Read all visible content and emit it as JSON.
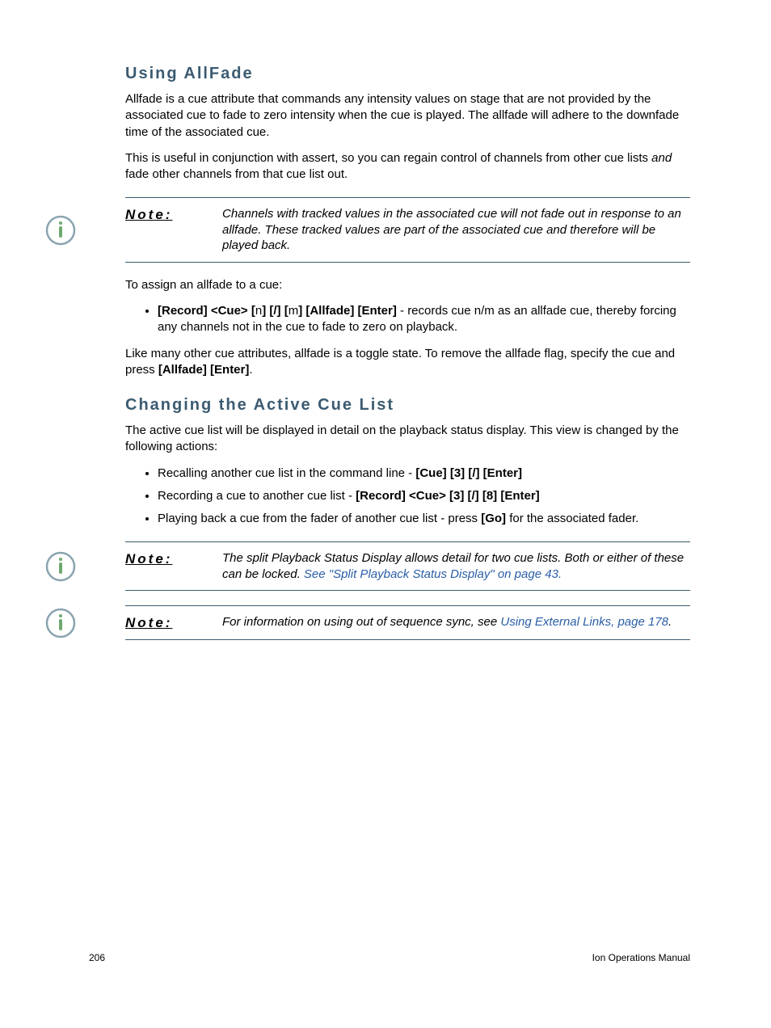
{
  "section1": {
    "title": "Using AllFade",
    "p1_a": "Allfade is a cue attribute that commands any intensity values on stage that are not provided by the associated cue to fade to zero intensity when the cue is played. The allfade will adhere to the downfade time of the associated cue.",
    "p2_a": "This is useful in conjunction with assert, so you can regain control of channels from other cue lists ",
    "p2_em": "and",
    "p2_b": " fade other channels from that cue list out."
  },
  "note1": {
    "label": "Note:",
    "body": "Channels with tracked values in the associated cue will not fade out in response to an allfade. These tracked values are part of the associated cue and therefore will be played back."
  },
  "section1b": {
    "p3": "To assign an allfade to a cue:",
    "bullet_bold_a": "[Record] <Cue> [",
    "bullet_n": "n",
    "bullet_bold_b": "] [/] [",
    "bullet_m": "m",
    "bullet_bold_c": "] [Allfade] [Enter]",
    "bullet_rest": " - records cue n/m as an allfade cue, thereby forcing any channels not in the cue to fade to zero on playback.",
    "p4_a": "Like many other cue attributes, allfade is a toggle state. To remove the allfade flag, specify the cue and press ",
    "p4_bold": "[Allfade] [Enter]",
    "p4_b": "."
  },
  "section2": {
    "title": "Changing the Active Cue List",
    "p1": "The active cue list will be displayed in detail on the playback status display. This view is changed by the following actions:",
    "bullets": {
      "b1_a": "Recalling another cue list in the command line - ",
      "b1_bold": "[Cue] [3] [/] [Enter]",
      "b2_a": "Recording a cue to another cue list - ",
      "b2_bold": "[Record] <Cue> [3] [/] [8] [Enter]",
      "b3_a": "Playing back a cue from the fader of another cue list - press ",
      "b3_bold": "[Go]",
      "b3_b": " for the associated fader."
    }
  },
  "note2": {
    "label": "Note:",
    "body_a": "The split Playback Status Display allows detail for two cue lists. Both or either of these can be locked. ",
    "link": "See \"Split Playback Status Display\" on page 43.",
    "body_b": ""
  },
  "note3": {
    "label": "Note:",
    "body_a": "For information on using out of sequence sync, see ",
    "link": "Using External Links, page 178",
    "body_b": "."
  },
  "footer": {
    "page_num": "206",
    "doc_title": "Ion Operations Manual"
  }
}
